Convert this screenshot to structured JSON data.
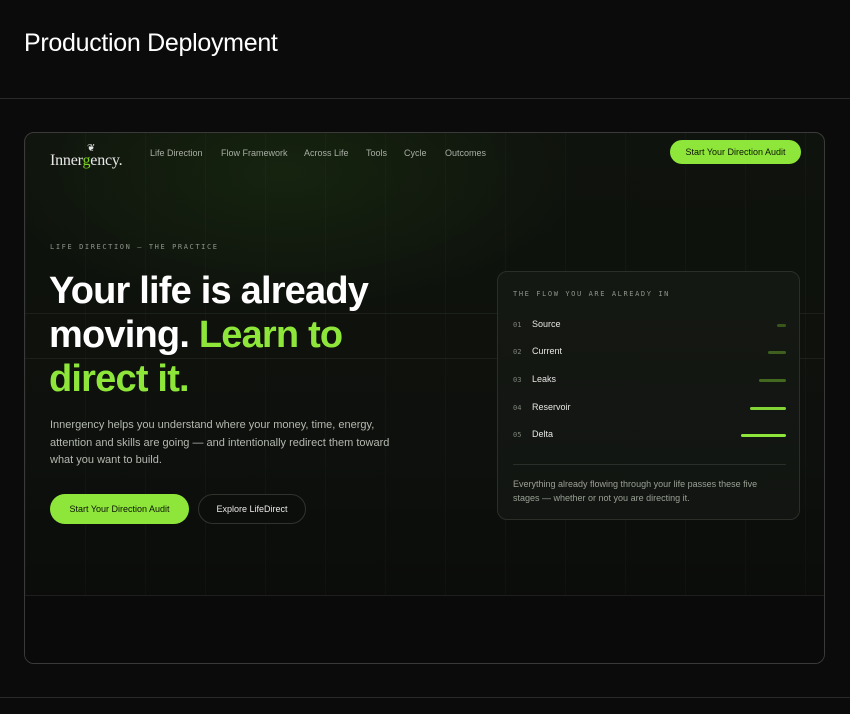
{
  "page": {
    "title": "Production Deployment"
  },
  "site": {
    "logo": {
      "text_before": "Inner",
      "text_accent": "g",
      "text_after": "ency.",
      "mark": "❦"
    },
    "nav": [
      {
        "label": "Life Direction"
      },
      {
        "label": "Flow Framework"
      },
      {
        "label": "Across Life"
      },
      {
        "label": "Tools"
      },
      {
        "label": "Cycle"
      },
      {
        "label": "Outcomes"
      }
    ],
    "nav_cta": "Start Your Direction Audit",
    "hero": {
      "eyebrow": "LIFE DIRECTION — THE PRACTICE",
      "headline_line1": "Your life is already",
      "headline_line2_white": "moving. ",
      "headline_line2_green": "Learn to",
      "headline_line3_green": "direct it.",
      "lead": "Innergency helps you understand where your money, time, energy, attention and skills are going — and intentionally redirect them toward what you want to build.",
      "primary_button": "Start Your Direction Audit",
      "secondary_button": "Explore LifeDirect"
    },
    "flow_card": {
      "title": "THE FLOW YOU ARE ALREADY IN",
      "stages": [
        {
          "num": "01",
          "name": "Source",
          "level": 0.2
        },
        {
          "num": "02",
          "name": "Current",
          "level": 0.4
        },
        {
          "num": "03",
          "name": "Leaks",
          "level": 0.6
        },
        {
          "num": "04",
          "name": "Reservoir",
          "level": 0.8
        },
        {
          "num": "05",
          "name": "Delta",
          "level": 1.0
        }
      ],
      "note": "Everything already flowing through your life passes these five stages — whether or not you are directing it."
    }
  },
  "colors": {
    "accent": "#8ee63a",
    "background": "#0b0b0b",
    "bar_dim": "#4e7a22",
    "bar_bright": "#8ee63a"
  }
}
